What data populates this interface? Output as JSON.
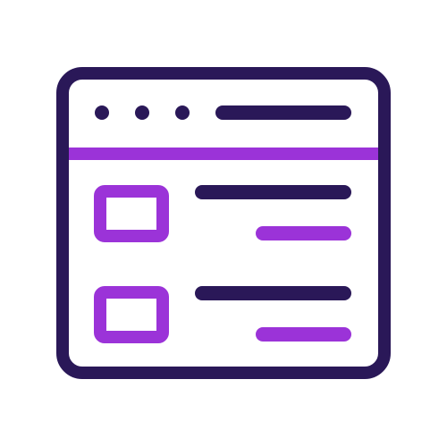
{
  "icon": {
    "name": "browser-window-list-icon",
    "colors": {
      "outline": "#2a1858",
      "accent": "#9b33d8",
      "background": "#ffffff"
    },
    "header": {
      "window_dots": 3
    },
    "list_items": [
      {
        "thumbnail_icon": "image-placeholder-icon"
      },
      {
        "thumbnail_icon": "image-placeholder-icon"
      }
    ]
  }
}
